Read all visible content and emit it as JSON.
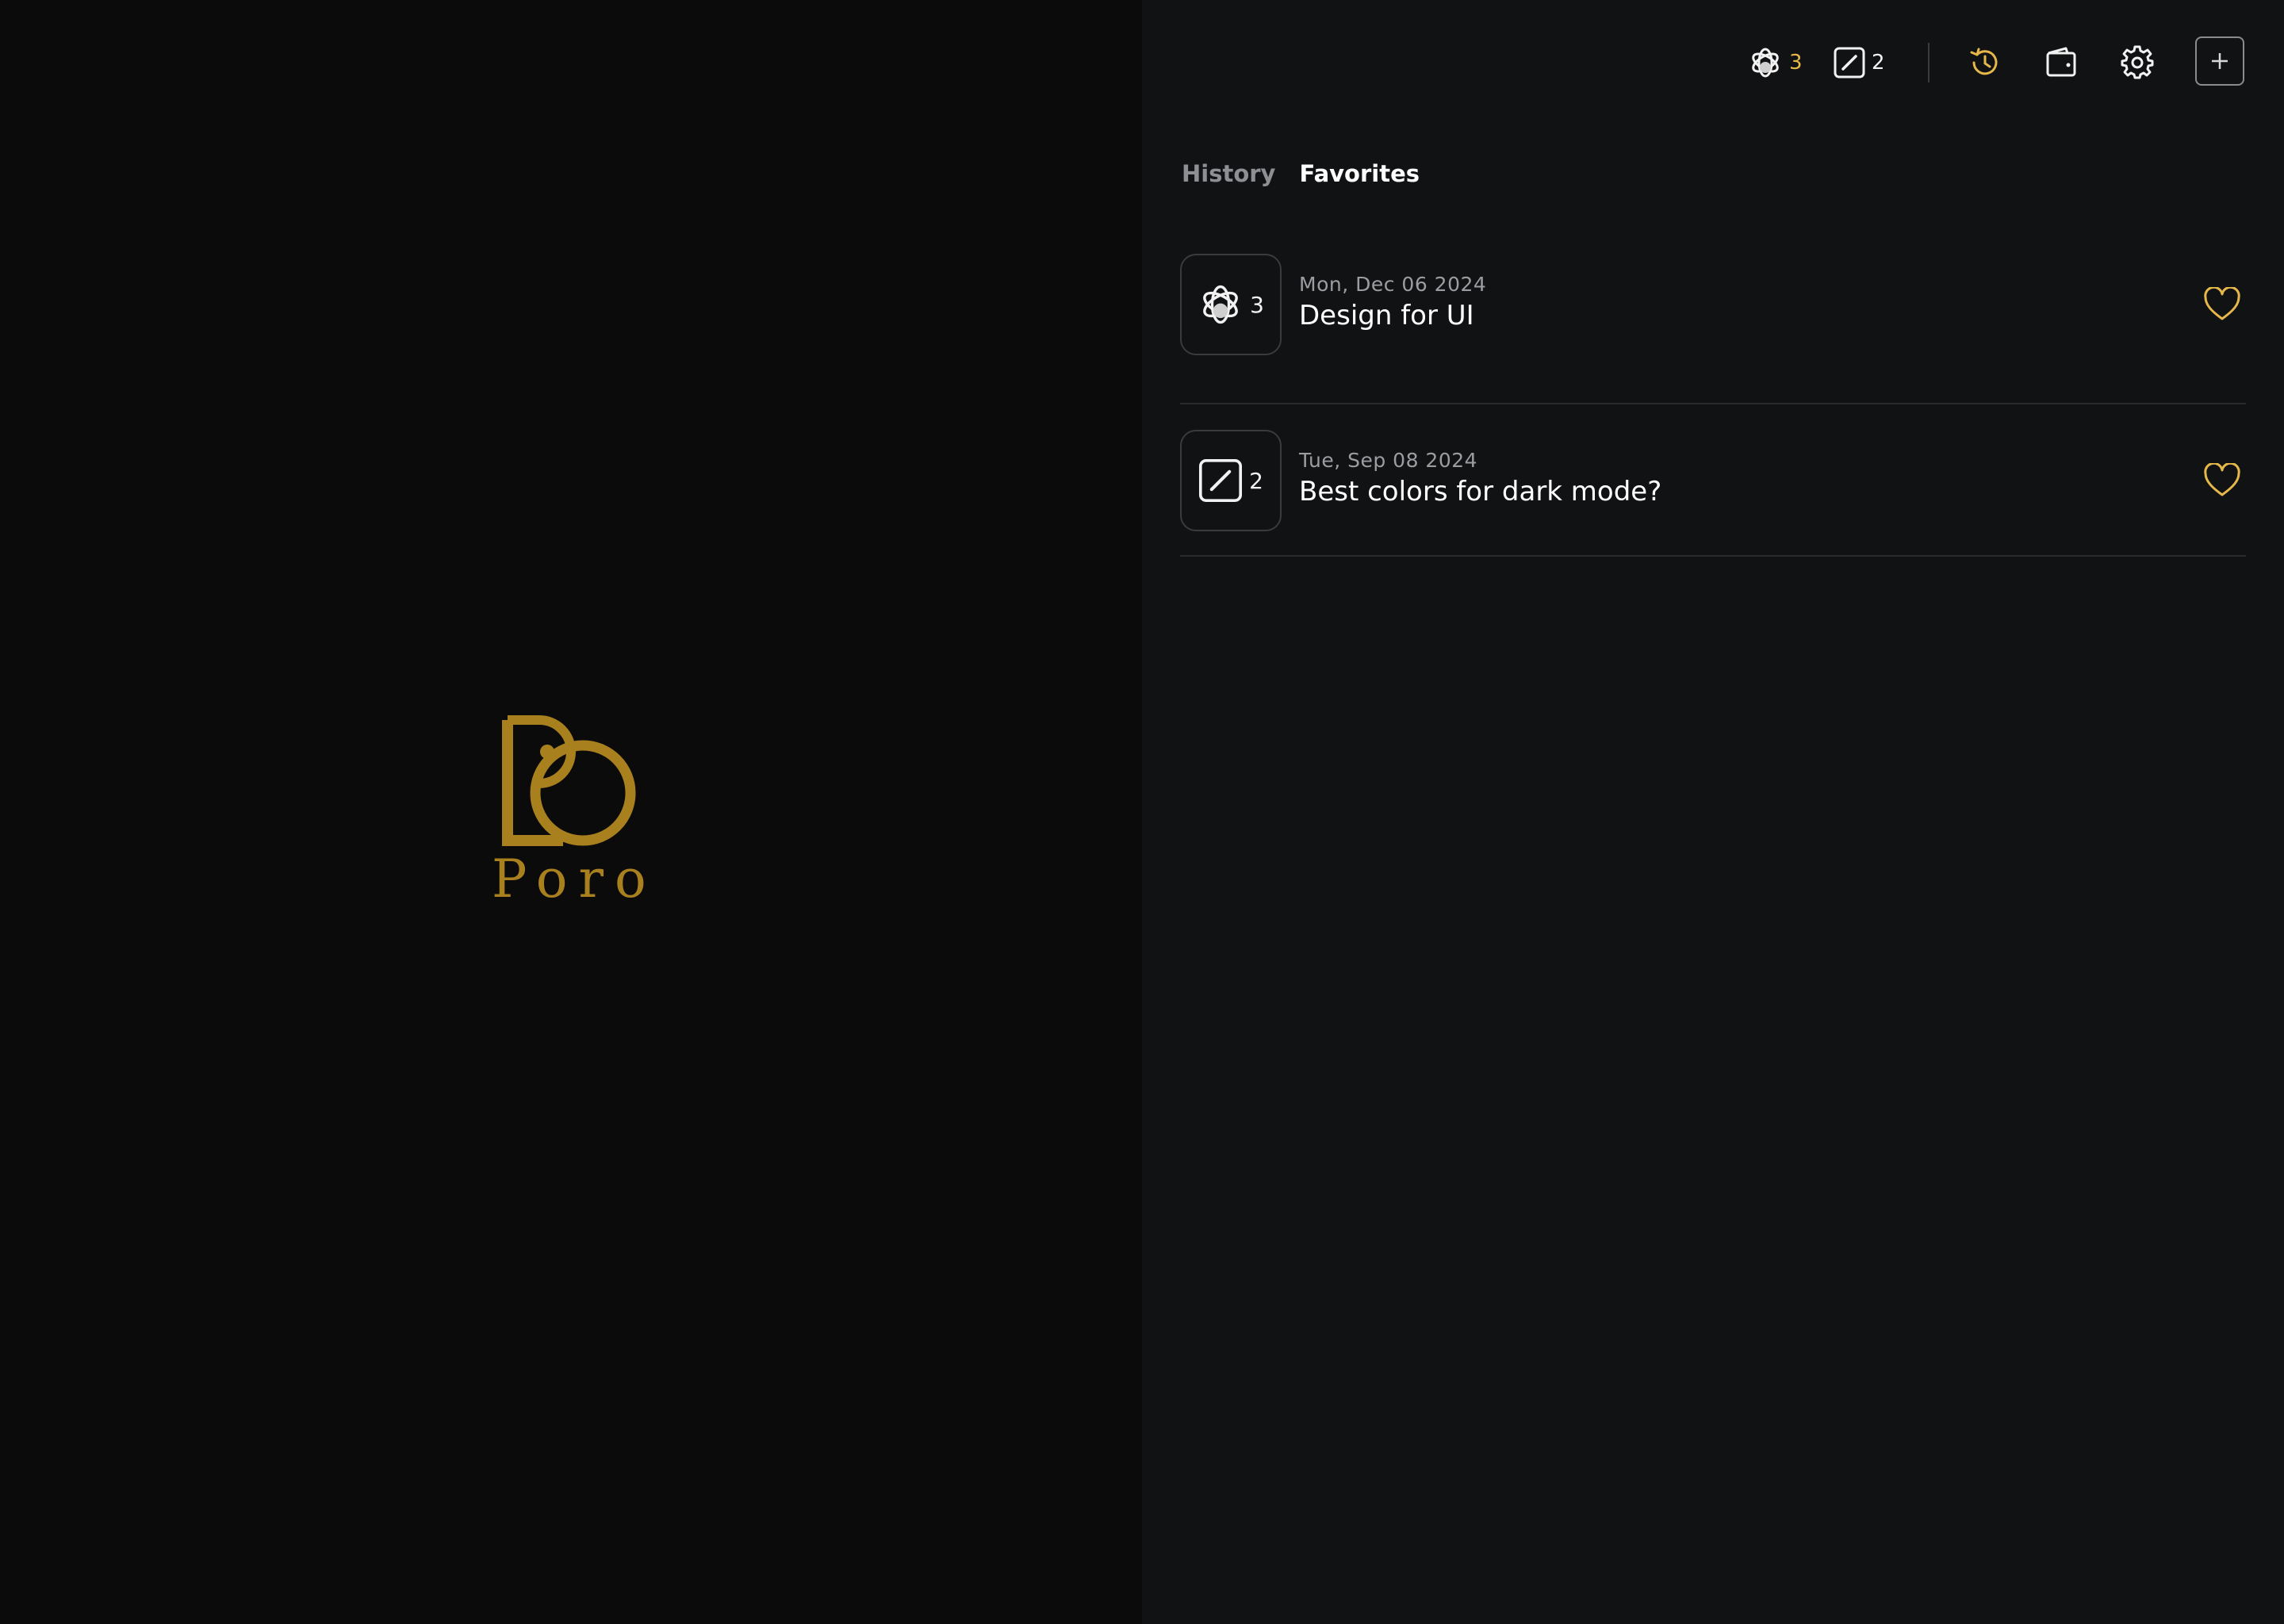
{
  "brand": {
    "name": "Poro",
    "color": "#a8801e"
  },
  "toolbar": {
    "model_a": {
      "icon": "openai-logo-icon",
      "count": "3",
      "count_color": "#e6b84a"
    },
    "model_b": {
      "icon": "slash-box-icon",
      "count": "2"
    },
    "history_icon": "history-icon",
    "wallet_icon": "wallet-icon",
    "settings_icon": "gear-icon",
    "new_icon": "plus-icon"
  },
  "tabs": [
    {
      "label": "History",
      "active": false
    },
    {
      "label": "Favorites",
      "active": true
    }
  ],
  "favorites": [
    {
      "icon": "openai-logo-icon",
      "count": "3",
      "date": "Mon, Dec 06 2024",
      "title": "Design for UI",
      "favorited": true
    },
    {
      "icon": "slash-box-icon",
      "count": "2",
      "date": "Tue, Sep 08 2024",
      "title": "Best colors for dark mode?",
      "favorited": true
    }
  ],
  "colors": {
    "accent": "#e6b84a",
    "background_left": "#0b0b0c",
    "background_right": "#111214"
  }
}
